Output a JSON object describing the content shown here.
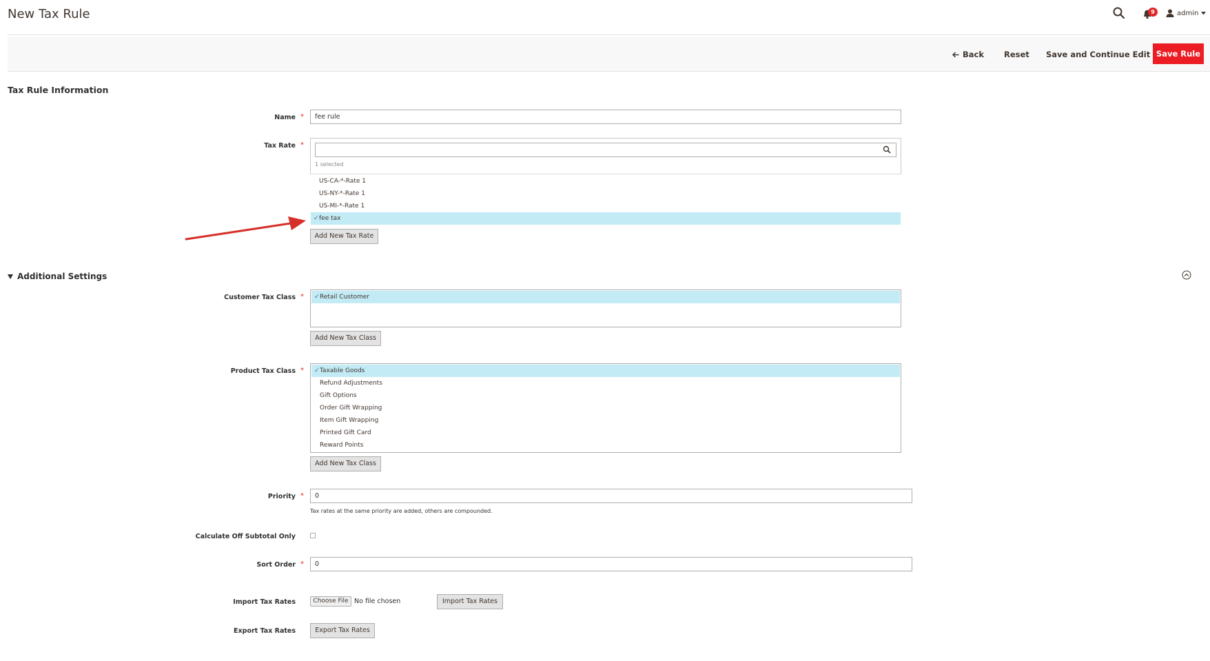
{
  "header": {
    "title": "New Tax Rule",
    "notifications_count": "9",
    "user_name": "admin"
  },
  "actions": {
    "back": "Back",
    "reset": "Reset",
    "save_continue": "Save and Continue Edit",
    "save": "Save Rule"
  },
  "tax_rule_info": {
    "title": "Tax Rule Information",
    "name_label": "Name",
    "name_value": "fee rule",
    "tax_rate_label": "Tax Rate",
    "tax_rate_search_value": "",
    "selected_count": "1 selected",
    "tax_rates": [
      {
        "label": "US-CA-*-Rate 1",
        "selected": false
      },
      {
        "label": "US-NY-*-Rate 1",
        "selected": false
      },
      {
        "label": "US-MI-*-Rate 1",
        "selected": false
      },
      {
        "label": "fee tax",
        "selected": true
      }
    ],
    "add_tax_rate": "Add New Tax Rate"
  },
  "additional": {
    "title": "Additional Settings",
    "customer_tax_class_label": "Customer Tax Class",
    "customer_classes": [
      {
        "label": "Retail Customer",
        "selected": true
      }
    ],
    "add_customer_class": "Add New Tax Class",
    "product_tax_class_label": "Product Tax Class",
    "product_classes": [
      {
        "label": "Taxable Goods",
        "selected": true
      },
      {
        "label": "Refund Adjustments",
        "selected": false
      },
      {
        "label": "Gift Options",
        "selected": false
      },
      {
        "label": "Order Gift Wrapping",
        "selected": false
      },
      {
        "label": "Item Gift Wrapping",
        "selected": false
      },
      {
        "label": "Printed Gift Card",
        "selected": false
      },
      {
        "label": "Reward Points",
        "selected": false
      }
    ],
    "add_product_class": "Add New Tax Class",
    "priority_label": "Priority",
    "priority_value": "0",
    "priority_note": "Tax rates at the same priority are added, others are compounded.",
    "calc_subtotal_label": "Calculate Off Subtotal Only",
    "calc_subtotal_checked": false,
    "sort_order_label": "Sort Order",
    "sort_order_value": "0",
    "import_label": "Import Tax Rates",
    "choose_file": "Choose File",
    "no_file": "No file chosen",
    "import_button": "Import Tax Rates",
    "export_label": "Export Tax Rates",
    "export_button": "Export Tax Rates"
  },
  "colors": {
    "primary_button": "#eb1c24",
    "selected_row": "#c2ebf5",
    "required": "#e22626",
    "annotation_arrow": "#d7302a"
  }
}
